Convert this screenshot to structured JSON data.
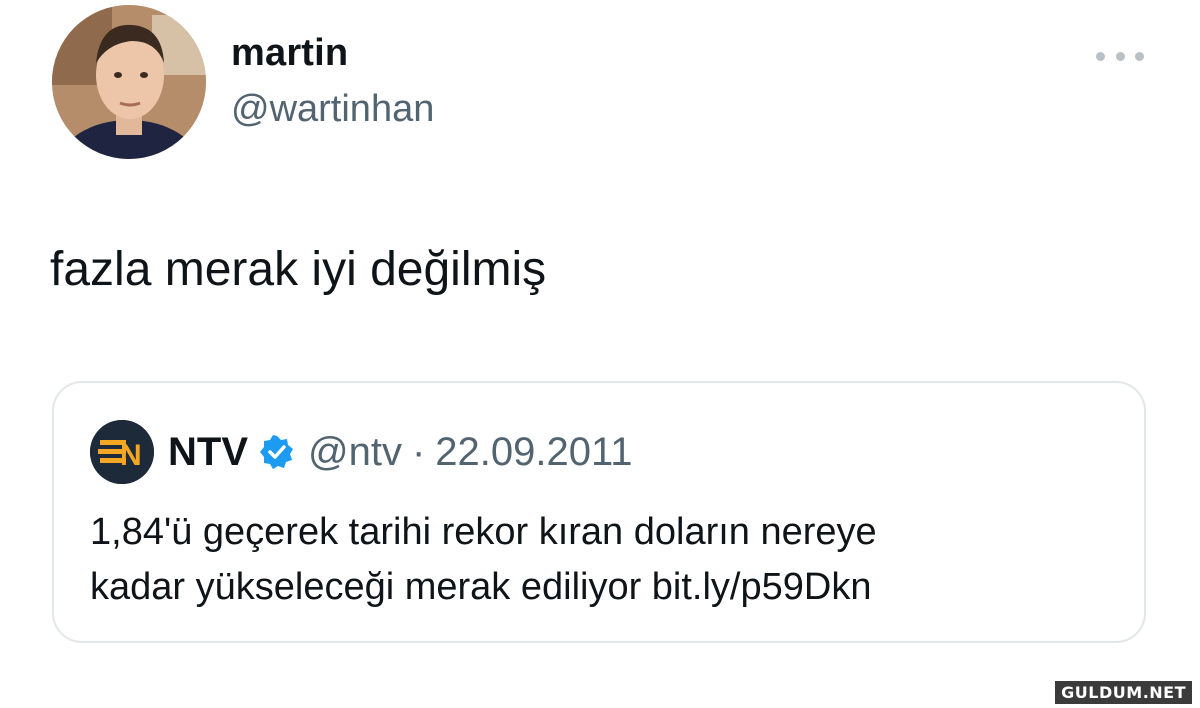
{
  "author": {
    "display_name": "martin",
    "username": "@wartinhan",
    "avatar_icon": "profile-avatar"
  },
  "tweet": {
    "text": "fazla merak iyi değilmiş"
  },
  "quoted_tweet": {
    "name": "NTV",
    "verified": true,
    "handle": "@ntv",
    "separator": "·",
    "date": "22.09.2011",
    "text_line_1": "1,84'ü geçerek tarihi rekor kıran doların nereye",
    "text_line_2": "kadar yükseleceği merak ediliyor bit.ly/p59Dkn",
    "logo_icon": "ntv-logo",
    "verified_color": "#1d9bf0"
  },
  "watermark": "GULDUM.NET",
  "colors": {
    "primary_text": "#0f1419",
    "secondary_text": "#536471",
    "card_border": "#e3e7ea"
  }
}
